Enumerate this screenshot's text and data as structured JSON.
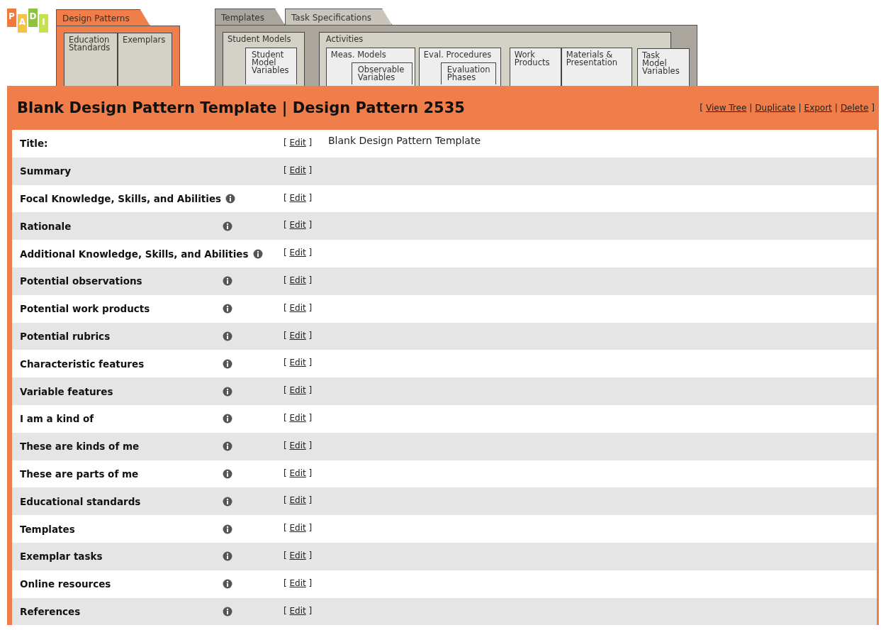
{
  "logo": {
    "letters": [
      {
        "char": "P",
        "color": "#f07a3c"
      },
      {
        "char": "A",
        "color": "#f5c342"
      },
      {
        "char": "D",
        "color": "#8cc43f"
      },
      {
        "char": "I",
        "color": "#c6e24a"
      }
    ]
  },
  "nav": {
    "design_patterns": {
      "tab": {
        "label": "Design Patterns",
        "selected": true
      },
      "subtabs": [
        "Education Standards",
        "Exemplars"
      ]
    },
    "templates": {
      "tabs": [
        {
          "label": "Templates",
          "selected": true
        },
        {
          "label": "Task Specifications",
          "selected": false
        }
      ],
      "student_models": {
        "label": "Student Models",
        "item": "Student Model Variables"
      },
      "activities": {
        "label": "Activities",
        "groups": [
          {
            "label": "Meas. Models",
            "item": "Observable Variables"
          },
          {
            "label": "Eval. Procedures",
            "item": "Evaluation Phases"
          }
        ],
        "items": [
          "Work Products",
          "Materials & Presentation"
        ]
      },
      "task_model": "Task Model Variables"
    }
  },
  "header": {
    "title": "Blank Design Pattern Template | Design Pattern 2535",
    "actions": [
      {
        "kind": "bracket",
        "text": "["
      },
      {
        "kind": "link",
        "text": "View Tree"
      },
      {
        "kind": "separator",
        "text": "|"
      },
      {
        "kind": "link",
        "text": "Duplicate"
      },
      {
        "kind": "separator",
        "text": "|"
      },
      {
        "kind": "link",
        "text": "Export"
      },
      {
        "kind": "separator",
        "text": "|"
      },
      {
        "kind": "link",
        "text": "Delete"
      },
      {
        "kind": "bracket",
        "text": "]"
      }
    ]
  },
  "rows": [
    {
      "label": "Title:",
      "info": false,
      "edit_open": "[",
      "edit": "Edit",
      "edit_close": "]",
      "value": "Blank Design Pattern Template"
    },
    {
      "label": "Summary",
      "info": false,
      "edit_open": "[",
      "edit": "Edit",
      "edit_close": "]"
    },
    {
      "label": "Focal Knowledge, Skills, and Abilities",
      "info": true,
      "edit_open": "[",
      "edit": "Edit",
      "edit_close": "]"
    },
    {
      "label": "Rationale",
      "info": true,
      "edit_open": "[",
      "edit": "Edit",
      "edit_close": "]"
    },
    {
      "label": "Additional Knowledge, Skills, and Abilities",
      "info": true,
      "edit_open": "[",
      "edit": "Edit",
      "edit_close": "]"
    },
    {
      "label": "Potential observations",
      "info": true,
      "edit_open": "[",
      "edit": "Edit",
      "edit_close": "]"
    },
    {
      "label": "Potential work products",
      "info": true,
      "edit_open": "[",
      "edit": "Edit",
      "edit_close": "]"
    },
    {
      "label": "Potential rubrics",
      "info": true,
      "edit_open": "[",
      "edit": "Edit",
      "edit_close": "]"
    },
    {
      "label": "Characteristic features",
      "info": true,
      "edit_open": "[",
      "edit": "Edit",
      "edit_close": "]"
    },
    {
      "label": "Variable features",
      "info": true,
      "edit_open": "[",
      "edit": "Edit",
      "edit_close": "]"
    },
    {
      "label": "I am a kind of",
      "info": true,
      "edit_open": "[",
      "edit": "Edit",
      "edit_close": "]"
    },
    {
      "label": "These are kinds of me",
      "info": true,
      "edit_open": "[",
      "edit": "Edit",
      "edit_close": "]"
    },
    {
      "label": "These are parts of me",
      "info": true,
      "edit_open": "[",
      "edit": "Edit",
      "edit_close": "]"
    },
    {
      "label": "Educational standards",
      "info": true,
      "edit_open": "[",
      "edit": "Edit",
      "edit_close": "]"
    },
    {
      "label": "Templates",
      "info": true,
      "edit_open": "[",
      "edit": "Edit",
      "edit_close": "]"
    },
    {
      "label": "Exemplar tasks",
      "info": true,
      "edit_open": "[",
      "edit": "Edit",
      "edit_close": "]"
    },
    {
      "label": "Online resources",
      "info": true,
      "edit_open": "[",
      "edit": "Edit",
      "edit_close": "]"
    },
    {
      "label": "References",
      "info": true,
      "edit_open": "[",
      "edit": "Edit",
      "edit_close": "]"
    }
  ]
}
